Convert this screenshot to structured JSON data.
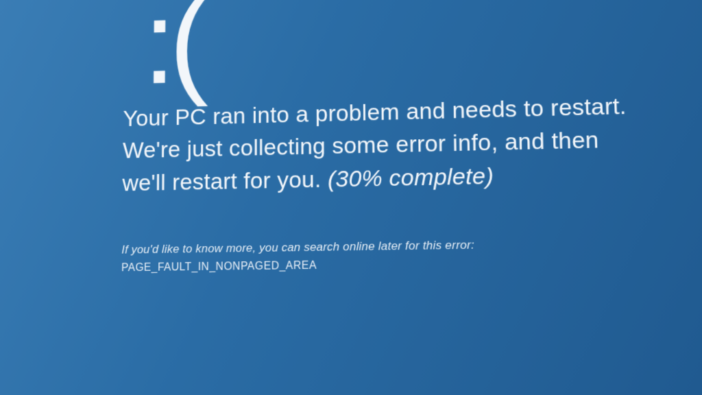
{
  "bsod": {
    "face": ":(",
    "line1": "Your PC ran into a problem and needs to restart.",
    "line2": "We're just collecting some error info, and then",
    "line3_prefix": "we'll restart for you. ",
    "progress_text": "(30% complete)",
    "progress_percent": 30,
    "info_prompt": "If you'd like to know more, you can search online later for this error:",
    "error_code": "PAGE_FAULT_IN_NONPAGED_AREA"
  },
  "colors": {
    "background": "#2a6ca5",
    "text": "#ffffff"
  }
}
